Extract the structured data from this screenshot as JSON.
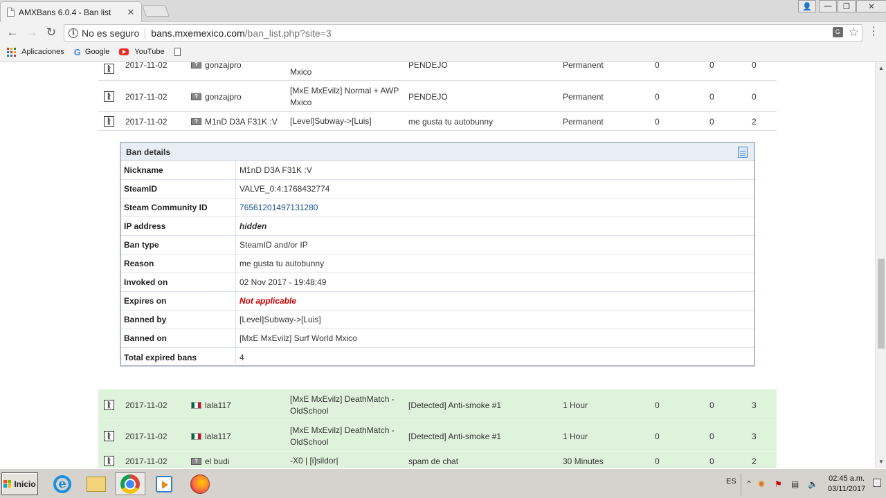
{
  "browser": {
    "tab_title": "AMXBans 6.0.4 - Ban list",
    "tab_close": "✕",
    "win_user": "👤",
    "win_min": "—",
    "win_max": "❐",
    "win_close": "✕",
    "back": "←",
    "forward": "→",
    "reload": "↻",
    "security_label": "No es seguro",
    "url_host": "bans.mxemexico.com",
    "url_path": "/ban_list.php?site=3",
    "bookmarks": {
      "apps": "Aplicaciones",
      "google": "Google",
      "youtube": "YouTube"
    },
    "icons": [
      "info-icon",
      "translate-icon",
      "star-icon",
      "menu-icon",
      "apps-icon",
      "google-icon",
      "youtube-icon",
      "page-icon"
    ]
  },
  "ban_rows_top": [
    {
      "date": "2017-11-02",
      "flag": "unknown",
      "nick": "gonzajpro",
      "server": "Mxico",
      "reason": "PENDEJO",
      "length": "Permanent",
      "n1": "0",
      "n2": "0",
      "n3": "0"
    },
    {
      "date": "2017-11-02",
      "flag": "unknown",
      "nick": "gonzajpro",
      "server": "[MxE MxEvilz] Normal + AWP Mxico",
      "reason": "PENDEJO",
      "length": "Permanent",
      "n1": "0",
      "n2": "0",
      "n3": "0"
    },
    {
      "date": "2017-11-02",
      "flag": "unknown",
      "nick": "M1nD D3A F31K :V",
      "server": "[Level]Subway->[Luis]",
      "reason": "me gusta tu autobunny",
      "length": "Permanent",
      "n1": "0",
      "n2": "0",
      "n3": "2"
    }
  ],
  "ban_details": {
    "title": "Ban details",
    "rows": [
      {
        "label": "Nickname",
        "value": "M1nD D3A F31K :V"
      },
      {
        "label": "SteamID",
        "value": "VALVE_0:4:1768432774"
      },
      {
        "label": "Steam Community ID",
        "value": "76561201497131280"
      },
      {
        "label": "IP address",
        "value": "hidden"
      },
      {
        "label": "Ban type",
        "value": "SteamID and/or IP"
      },
      {
        "label": "Reason",
        "value": "me gusta tu autobunny"
      },
      {
        "label": "Invoked on",
        "value": "02 Nov 2017 - 19:48:49"
      },
      {
        "label": "Expires on",
        "value": "Not applicable"
      },
      {
        "label": "Banned by",
        "value": "[Level]Subway->[Luis]"
      },
      {
        "label": "Banned on",
        "value": "[MxE MxEvilz] Surf World Mxico"
      },
      {
        "label": "Total expired bans",
        "value": "4"
      }
    ]
  },
  "ban_rows_bottom": [
    {
      "date": "2017-11-02",
      "flag": "mx",
      "nick": "lala117",
      "server": "[MxE MxEvilz] DeathMatch - OldSchool",
      "reason": "[Detected] Anti-smoke #1",
      "length": "1 Hour",
      "n1": "0",
      "n2": "0",
      "n3": "3"
    },
    {
      "date": "2017-11-02",
      "flag": "mx",
      "nick": "lala117",
      "server": "[MxE MxEvilz] DeathMatch - OldSchool",
      "reason": "[Detected] Anti-smoke #1",
      "length": "1 Hour",
      "n1": "0",
      "n2": "0",
      "n3": "3"
    },
    {
      "date": "2017-11-02",
      "flag": "unknown",
      "nick": "el budi",
      "server": "-X0 | [i]sildor|",
      "reason": "spam de chat",
      "length": "30 Minutes",
      "n1": "0",
      "n2": "0",
      "n3": "2"
    }
  ],
  "taskbar": {
    "start_label": "Inicio",
    "language": "ES",
    "time": "02:45 a.m.",
    "date": "03/11/2017",
    "apps": [
      "internet-explorer-icon",
      "file-explorer-icon",
      "chrome-icon",
      "media-player-icon",
      "firefox-icon"
    ]
  },
  "colors": {
    "row_green": "#dff3dc",
    "details_header": "#e9edf5",
    "link": "#1a4e8a",
    "not_applicable": "#cc0000"
  }
}
